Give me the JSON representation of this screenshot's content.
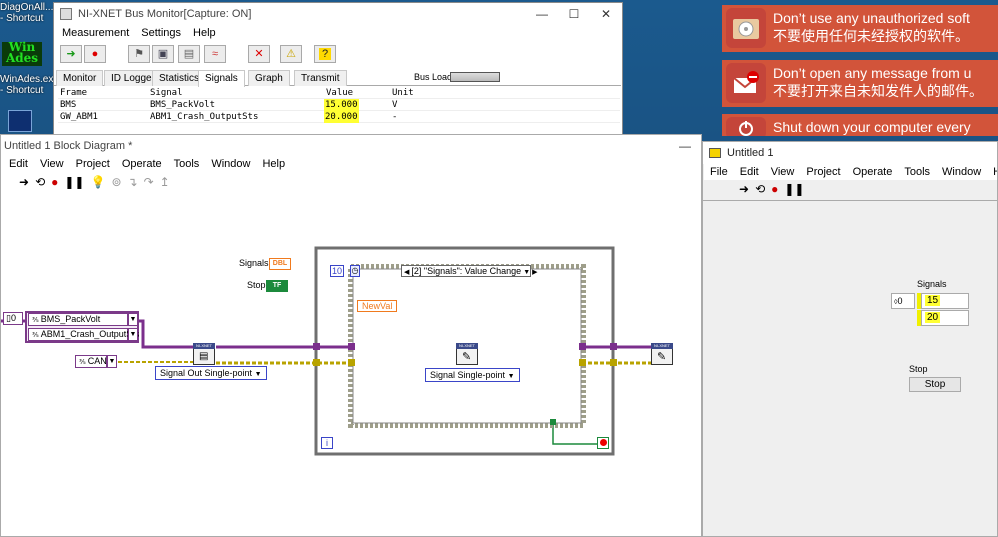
{
  "desktop": {
    "icons": [
      {
        "label": "DiagOnAll... - Shortcut"
      },
      {
        "label": "WinAdes.exe - Shortcut"
      }
    ],
    "logo_text": "Win Ades"
  },
  "notifications": [
    {
      "line1": "Don’t use any unauthorized soft",
      "line2": "不要使用任何未经授权的软件。",
      "icon": "disc-icon"
    },
    {
      "line1": "Don’t open any message from u",
      "line2": "不要打开来自未知发件人的邮件。",
      "icon": "mail-block-icon"
    },
    {
      "line1": "Shut down your computer every",
      "line2": "",
      "icon": "power-icon"
    }
  ],
  "bus_monitor": {
    "title": "NI-XNET Bus Monitor[Capture: ON]",
    "menu": [
      "Measurement",
      "Settings",
      "Help"
    ],
    "tabs": [
      "Monitor",
      "ID Logger",
      "Statistics",
      "Signals",
      "Graph",
      "Transmit"
    ],
    "active_tab": "Signals",
    "bus_load_label": "Bus Load:",
    "columns": [
      "Frame",
      "Signal",
      "Value",
      "Unit"
    ],
    "rows": [
      {
        "frame": "BMS",
        "signal": "BMS_PackVolt",
        "value": "15.000",
        "unit": "V"
      },
      {
        "frame": "GW_ABM1",
        "signal": "ABM1_Crash_OutputSts",
        "value": "20.000",
        "unit": "-"
      }
    ]
  },
  "block_diagram": {
    "title": "Untitled 1 Block Diagram *",
    "menu": [
      "Edit",
      "View",
      "Project",
      "Operate",
      "Tools",
      "Window",
      "Help"
    ],
    "signals_label": "Signals",
    "signals_tag": "DBL",
    "stop_label": "Stop",
    "stop_tag": "TF",
    "array_index": "0",
    "signal_items": [
      "BMS_PackVolt",
      "ABM1_Crash_OutputSts"
    ],
    "interface": "CAN1",
    "write_mode": "Signal Out Single-point",
    "event_case": "[2] \"Signals\": Value Change",
    "timeout": "10",
    "newval_label": "NewVal",
    "write_vi_mode": "Signal Single-point",
    "node_tag": "NI-XNET",
    "loop_iteration": "i"
  },
  "front_panel": {
    "title": "Untitled 1",
    "menu": [
      "File",
      "Edit",
      "View",
      "Project",
      "Operate",
      "Tools",
      "Window",
      "Help"
    ],
    "signals_label": "Signals",
    "index": "0",
    "values": [
      "15",
      "20"
    ],
    "stop_label": "Stop",
    "stop_button": "Stop"
  },
  "colors": {
    "highlight": "#ffff33",
    "cluster_wire": "#7b2f8c",
    "error_wire": "#b8a300",
    "toast": "#d2543a"
  }
}
